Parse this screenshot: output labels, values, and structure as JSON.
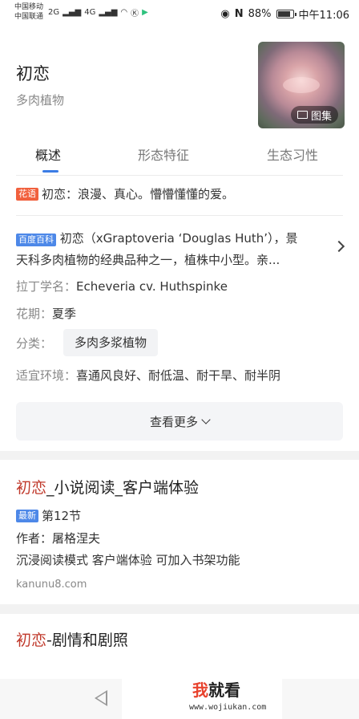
{
  "status_bar": {
    "carrier_1": "中国移动",
    "carrier_2": "中国联通",
    "net_1": "2G",
    "net_2": "4G",
    "battery": "88%",
    "battery_level": 0.88,
    "time": "中午11:06"
  },
  "entity": {
    "title": "初恋",
    "subtitle": "多肉植物",
    "gallery_label": "图集",
    "tabs": [
      {
        "label": "概述",
        "active": true
      },
      {
        "label": "形态特征",
        "active": false
      },
      {
        "label": "生态习性",
        "active": false
      }
    ],
    "flower_language": {
      "tag": "花语",
      "text": "初恋：浪漫、真心。懵懵懂懂的爱。"
    },
    "baike": {
      "tag": "百度百科",
      "line1": "初恋（xGraptoveria ‘Douglas Huth’），景",
      "line2": "天科多肉植物的经典品种之一，植株中小型。亲..."
    },
    "latin_label": "拉丁学名：",
    "latin_value": "Echeveria cv. Huthspinke",
    "bloom_label": "花期：",
    "bloom_value": "夏季",
    "category_label": "分类：",
    "category_value": "多肉多浆植物",
    "env_label": "适宜环境：",
    "env_value": "喜通风良好、耐低温、耐干旱、耐半阴",
    "more_label": "查看更多"
  },
  "result_novel": {
    "title_hl": "初恋",
    "title_rest": "_小说阅读_客户端体验",
    "tag": "最新",
    "latest": "第12节",
    "author": "作者：屠格涅夫",
    "desc": "沉浸阅读模式 客户端体验 可加入书架功能",
    "url": "kanunu8.com"
  },
  "result_drama": {
    "title_hl": "初恋",
    "title_rest": "-剧情和剧照"
  },
  "watermark": {
    "logo_wo": "我",
    "logo_rest": "就看",
    "url": "www.wojiukan.com"
  }
}
